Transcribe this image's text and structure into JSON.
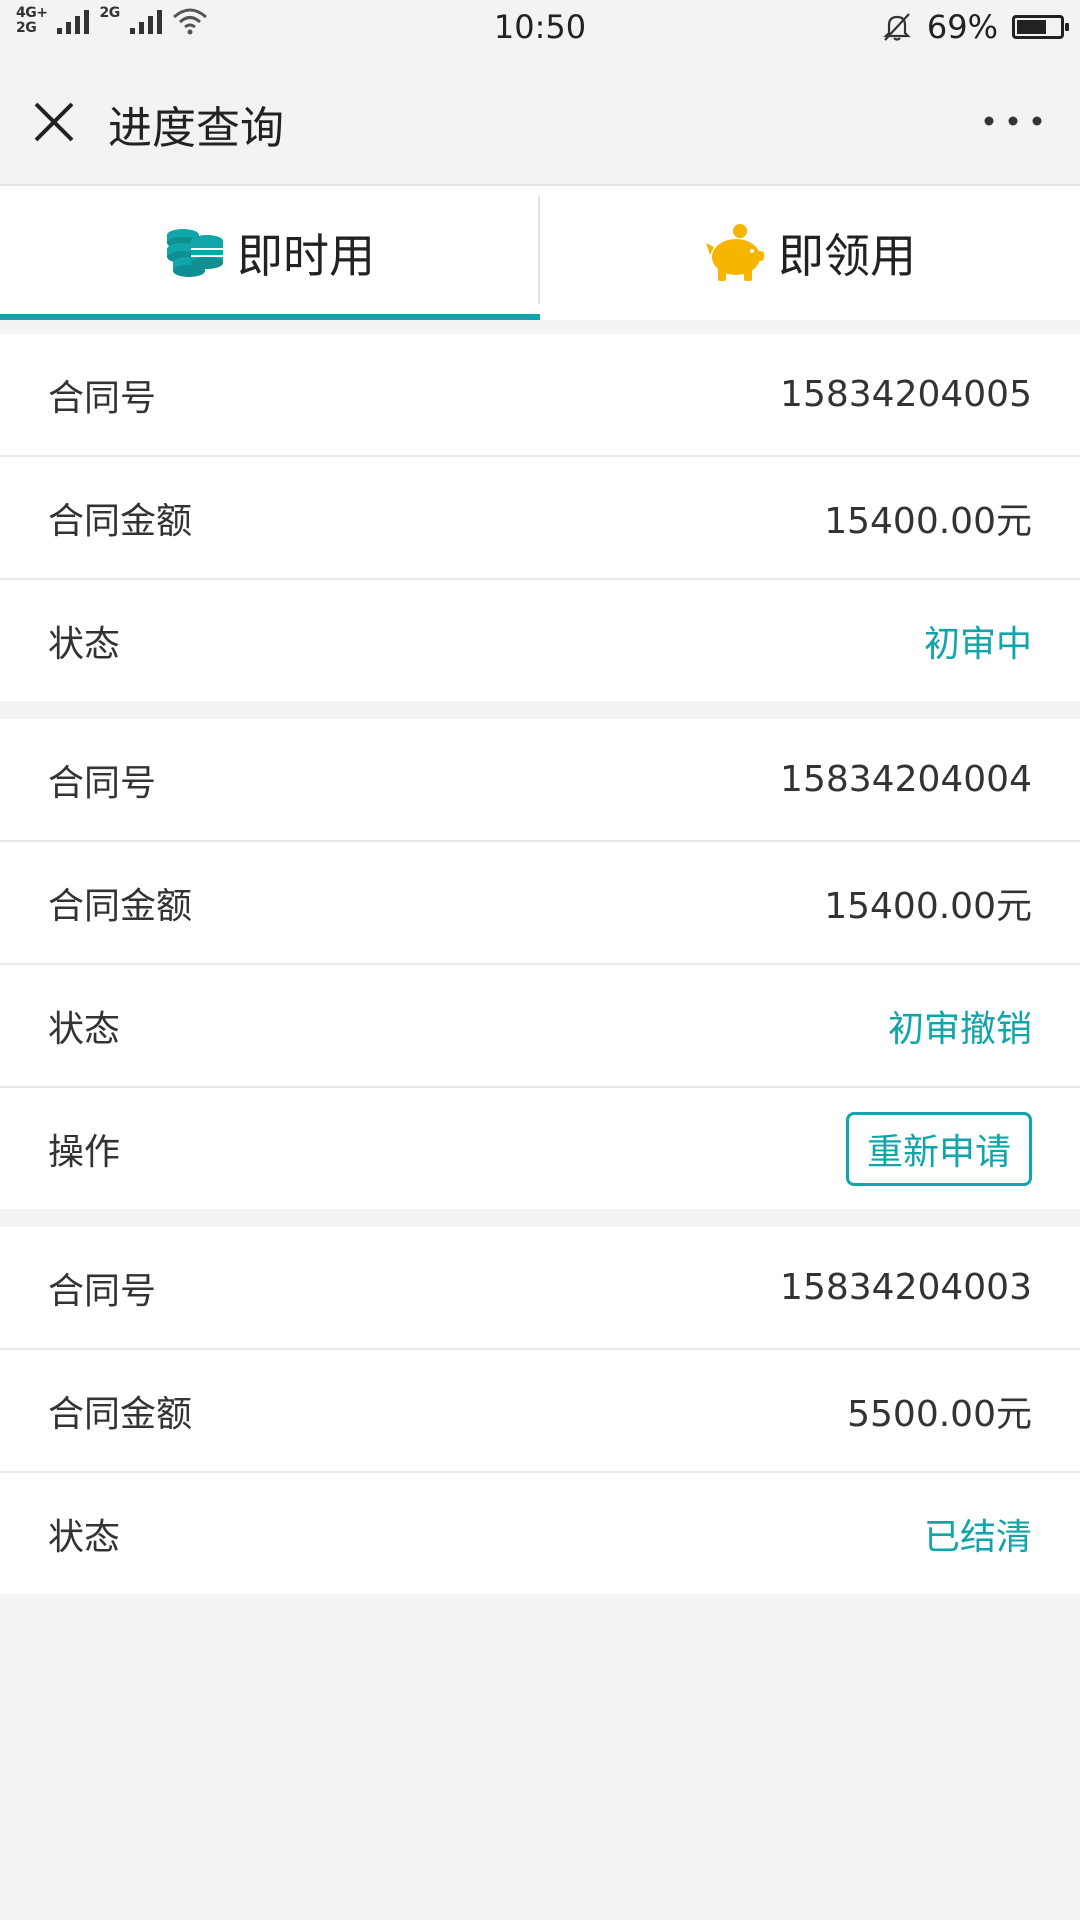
{
  "status_bar": {
    "network_1": "4G+",
    "network_2": "2G",
    "network_3": "2G",
    "time": "10:50",
    "battery_pct": "69%",
    "battery_level": 0.69
  },
  "header": {
    "title": "进度查询"
  },
  "tabs": [
    {
      "label": "即时用",
      "icon": "coins-stack-icon",
      "active": true
    },
    {
      "label": "即领用",
      "icon": "piggy-bank-icon",
      "active": false
    }
  ],
  "colors": {
    "accent": "#10a5a8",
    "piggy": "#f7b500"
  },
  "records": [
    {
      "contract_no_label": "合同号",
      "contract_no": "15834204005",
      "amount_label": "合同金额",
      "amount": "15400.00元",
      "status_label": "状态",
      "status": "初审中"
    },
    {
      "contract_no_label": "合同号",
      "contract_no": "15834204004",
      "amount_label": "合同金额",
      "amount": "15400.00元",
      "status_label": "状态",
      "status": "初审撤销",
      "action_label": "操作",
      "action_button": "重新申请"
    },
    {
      "contract_no_label": "合同号",
      "contract_no": "15834204003",
      "amount_label": "合同金额",
      "amount": "5500.00元",
      "status_label": "状态",
      "status": "已结清"
    }
  ]
}
